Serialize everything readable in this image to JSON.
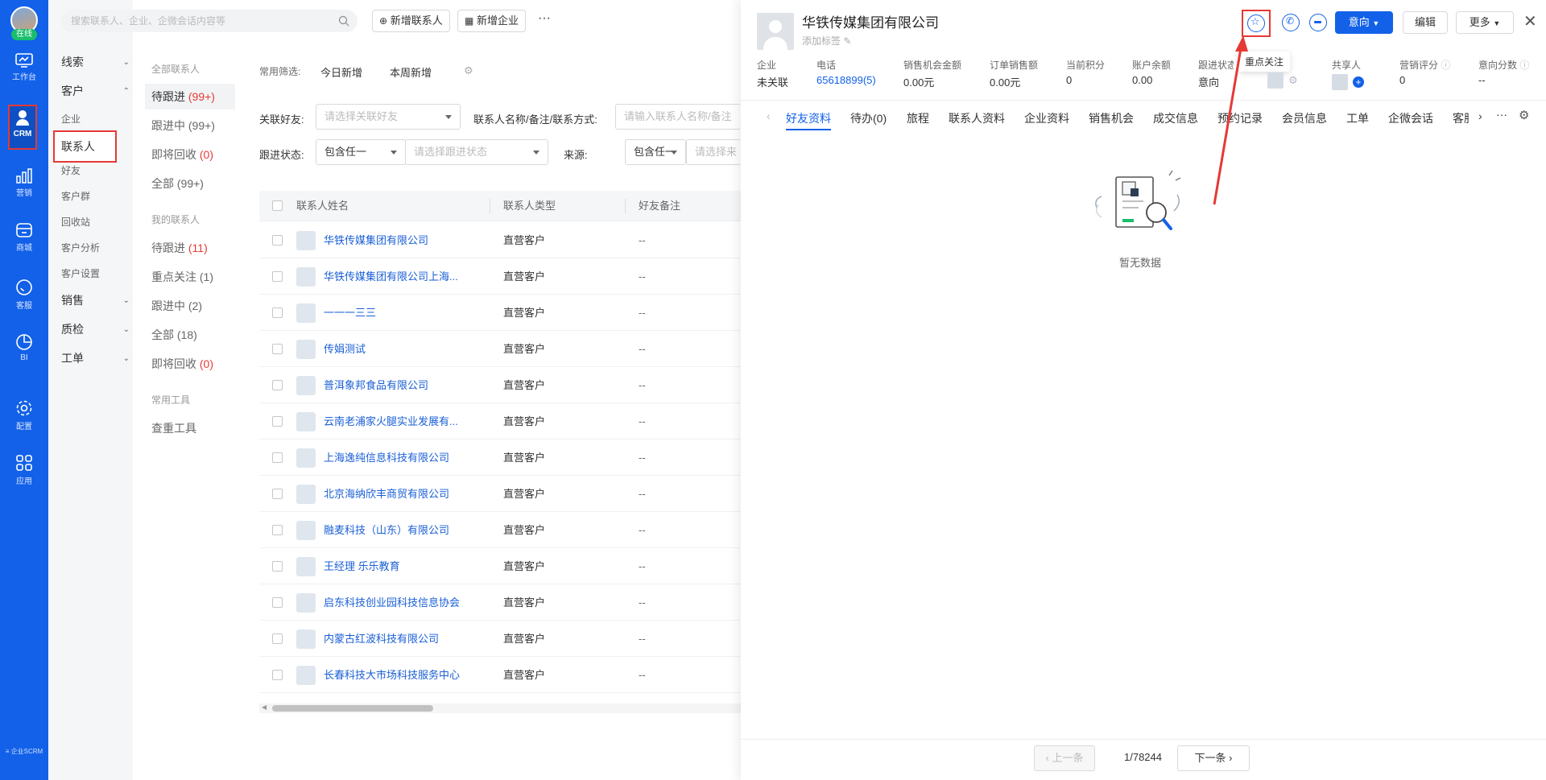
{
  "rail": {
    "status": "在线",
    "items": [
      {
        "label": "工作台",
        "icon": "dashboard-icon"
      },
      {
        "label": "CRM",
        "icon": "user-icon"
      },
      {
        "label": "营销",
        "icon": "bar-chart-icon"
      },
      {
        "label": "商城",
        "icon": "store-icon"
      },
      {
        "label": "客服",
        "icon": "chat-icon"
      },
      {
        "label": "BI",
        "icon": "pie-chart-icon"
      },
      {
        "label": "配置",
        "icon": "gear-icon"
      },
      {
        "label": "应用",
        "icon": "apps-grid-icon"
      }
    ],
    "footer": "≡ 企业SCRM"
  },
  "menu2": {
    "groups": [
      {
        "label": "线索"
      },
      {
        "label": "客户"
      },
      {
        "label": "销售"
      },
      {
        "label": "质检"
      },
      {
        "label": "工单"
      }
    ],
    "customer_items": [
      "企业",
      "联系人",
      "好友",
      "客户群",
      "回收站",
      "客户分析",
      "客户设置"
    ]
  },
  "col3": {
    "all_header": "全部联系人",
    "all_items": [
      {
        "label": "待跟进",
        "count": "(99+)"
      },
      {
        "label": "跟进中",
        "count": "(99+)"
      },
      {
        "label": "即将回收",
        "count": "(0)"
      },
      {
        "label": "全部",
        "count": "(99+)"
      }
    ],
    "mine_header": "我的联系人",
    "mine_items": [
      {
        "label": "待跟进",
        "count": "(11)"
      },
      {
        "label": "重点关注",
        "count": "(1)"
      },
      {
        "label": "跟进中",
        "count": "(2)"
      },
      {
        "label": "全部",
        "count": "(18)"
      },
      {
        "label": "即将回收",
        "count": "(0)"
      }
    ],
    "tools_header": "常用工具",
    "tools": [
      "查重工具"
    ]
  },
  "topbar": {
    "search_placeholder": "搜索联系人、企业、企微会话内容等",
    "add_contact": "新增联系人",
    "add_company": "新增企业",
    "more": "···"
  },
  "filters": {
    "quick_label": "常用筛选:",
    "quick_today": "今日新增",
    "quick_week": "本周新增",
    "friend_label": "关联好友:",
    "friend_placeholder": "请选择关联好友",
    "name_label": "联系人名称/备注/联系方式:",
    "name_placeholder": "请输入联系人名称/备注",
    "status_label": "跟进状态:",
    "status_mode": "包含任一",
    "status_placeholder": "请选择跟进状态",
    "source_label": "来源:",
    "source_mode": "包含任一",
    "source_placeholder": "请选择来"
  },
  "table": {
    "headers": [
      "联系人姓名",
      "联系人类型",
      "好友备注"
    ],
    "rows": [
      {
        "name": "华铁传媒集团有限公司",
        "type": "直营客户",
        "note": "--"
      },
      {
        "name": "华铁传媒集团有限公司上海...",
        "type": "直营客户",
        "note": "--"
      },
      {
        "name": "一一一三三",
        "type": "直营客户",
        "note": "--"
      },
      {
        "name": "传娟测试",
        "type": "直营客户",
        "note": "--"
      },
      {
        "name": "普洱象邦食品有限公司",
        "type": "直营客户",
        "note": "--"
      },
      {
        "name": "云南老浦家火腿实业发展有...",
        "type": "直营客户",
        "note": "--"
      },
      {
        "name": "上海逸纯信息科技有限公司",
        "type": "直营客户",
        "note": "--"
      },
      {
        "name": "北京海纳欣丰商贸有限公司",
        "type": "直营客户",
        "note": "--"
      },
      {
        "name": "融麦科技（山东）有限公司",
        "type": "直营客户",
        "note": "--"
      },
      {
        "name": "王经理 乐乐教育",
        "type": "直营客户",
        "note": "--"
      },
      {
        "name": "启东科技创业园科技信息协会",
        "type": "直营客户",
        "note": "--"
      },
      {
        "name": "内蒙古红波科技有限公司",
        "type": "直营客户",
        "note": "--"
      },
      {
        "name": "长春科技大市场科技服务中心",
        "type": "直营客户",
        "note": "--"
      }
    ]
  },
  "detail": {
    "title": "华铁传媒集团有限公司",
    "add_tag": "添加标签",
    "intent_button": "意向",
    "edit_button": "编辑",
    "more_button": "更多",
    "tooltip": "重点关注",
    "fields": [
      {
        "label": "企业",
        "value": "未关联"
      },
      {
        "label": "电话",
        "value": "65618899(5)"
      },
      {
        "label": "销售机会金额",
        "value": "0.00元"
      },
      {
        "label": "订单销售额",
        "value": "0.00元"
      },
      {
        "label": "当前积分",
        "value": "0"
      },
      {
        "label": "账户余额",
        "value": "0.00"
      },
      {
        "label": "跟进状态",
        "value": "意向"
      }
    ],
    "sharer_label": "共享人",
    "score_label": "营销评分",
    "score_value": "0",
    "intent_score_label": "意向分数",
    "intent_score_value": "--",
    "tabs": [
      "好友资料",
      "待办(0)",
      "旅程",
      "联系人资料",
      "企业资料",
      "销售机会",
      "成交信息",
      "预约记录",
      "会员信息",
      "工单",
      "企微会话",
      "客服"
    ],
    "empty_text": "暂无数据",
    "prev": "上一条",
    "page": "1/78244",
    "next": "下一条"
  },
  "colors": {
    "primary": "#1261e8",
    "highlight": "#e53935",
    "link": "#1a5fd6"
  }
}
